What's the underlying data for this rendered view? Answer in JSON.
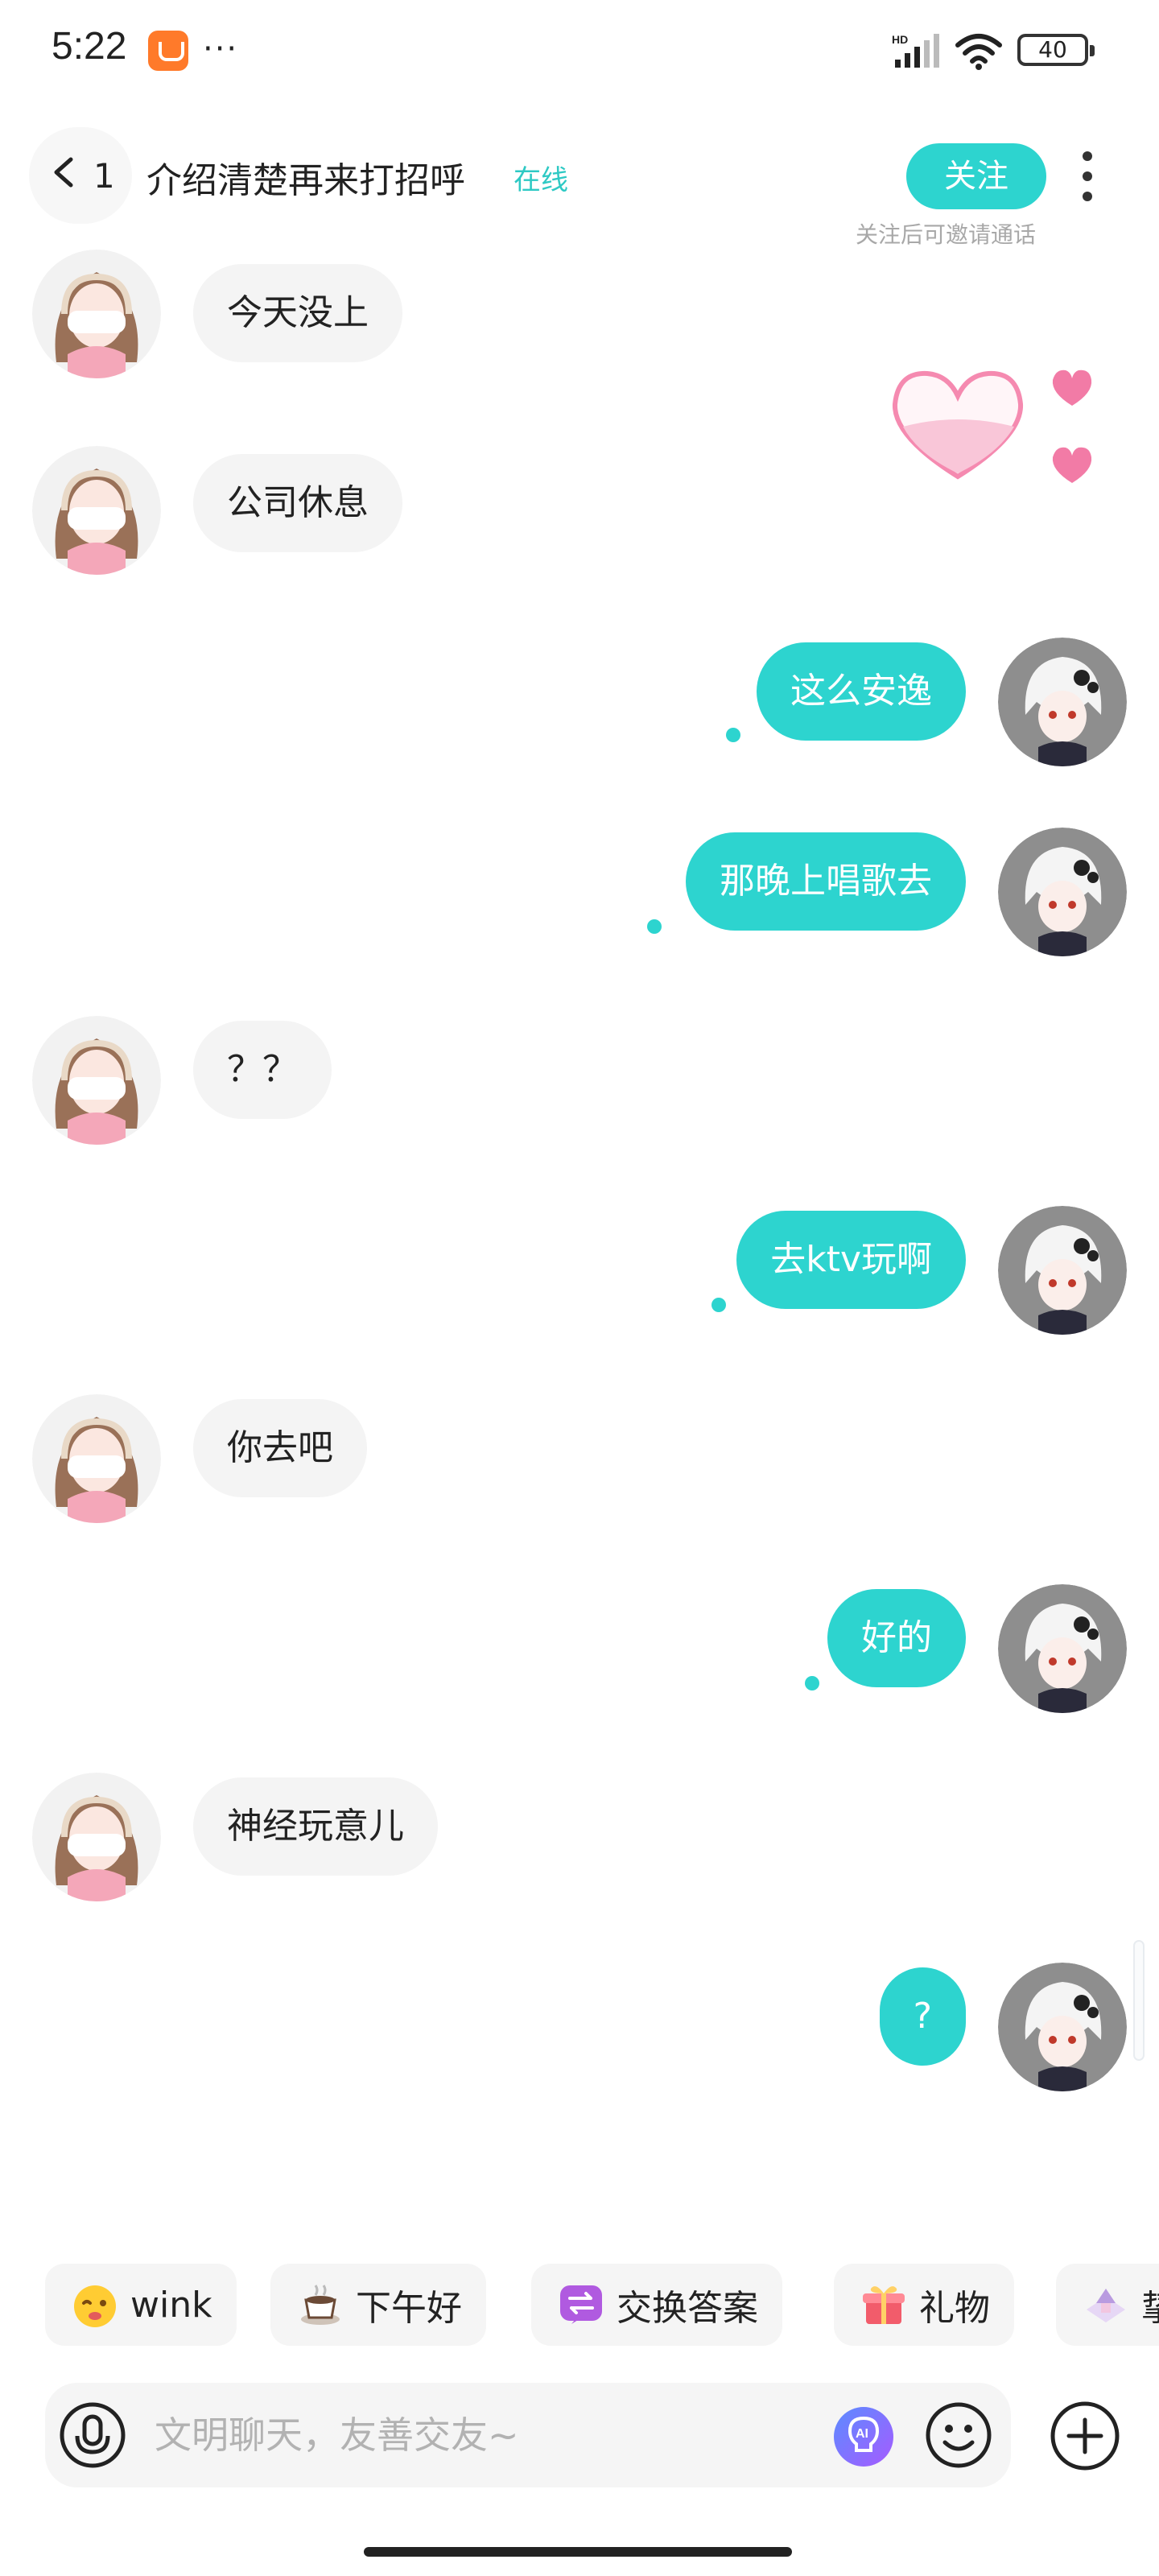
{
  "status_bar": {
    "time": "5:22",
    "more_dots": "···",
    "network_badge": "HD",
    "battery_level": "40"
  },
  "header": {
    "unread_count": "1",
    "title": "介绍清楚再来打招呼",
    "online_status": "在线",
    "follow_label": "关注",
    "follow_hint": "关注后可邀请通话"
  },
  "colors": {
    "accent": "#2dd4cf",
    "incoming_bubble": "#f4f4f4",
    "follow_hint": "#a8a8a8"
  },
  "messages": [
    {
      "side": "in",
      "text": "今天没上"
    },
    {
      "side": "out",
      "type": "sticker",
      "sticker": "pink-heart-sticker"
    },
    {
      "side": "in",
      "text": "公司休息"
    },
    {
      "side": "out",
      "text": "这么安逸"
    },
    {
      "side": "out",
      "text": "那晚上唱歌去"
    },
    {
      "side": "in",
      "text": "？？"
    },
    {
      "side": "out",
      "text": "去ktv玩啊"
    },
    {
      "side": "in",
      "text": "你去吧"
    },
    {
      "side": "out",
      "text": "好的"
    },
    {
      "side": "in",
      "text": "神经玩意儿"
    },
    {
      "side": "out",
      "text": "?"
    }
  ],
  "quick_actions": [
    {
      "label": "wink",
      "icon": "wink-emoji-icon"
    },
    {
      "label": "下午好",
      "icon": "coffee-cup-icon"
    },
    {
      "label": "交换答案",
      "icon": "exchange-icon"
    },
    {
      "label": "礼物",
      "icon": "gift-icon"
    },
    {
      "label": "挚",
      "icon": "house-icon"
    }
  ],
  "input": {
    "placeholder": "文明聊天，友善交友~",
    "value": ""
  }
}
